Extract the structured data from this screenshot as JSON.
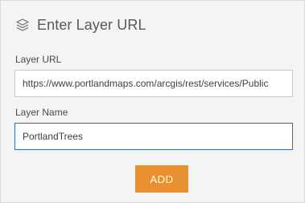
{
  "dialog": {
    "title": "Enter Layer URL",
    "icon": "layers-icon"
  },
  "layer_url": {
    "label": "Layer URL",
    "value": "https://www.portlandmaps.com/arcgis/rest/services/Public"
  },
  "layer_name": {
    "label": "Layer Name",
    "value": "PortlandTrees"
  },
  "actions": {
    "add_label": "ADD"
  },
  "colors": {
    "accent": "#e8902f",
    "focus_border": "#3a6ea5",
    "panel_bg": "#f4f4f4"
  }
}
